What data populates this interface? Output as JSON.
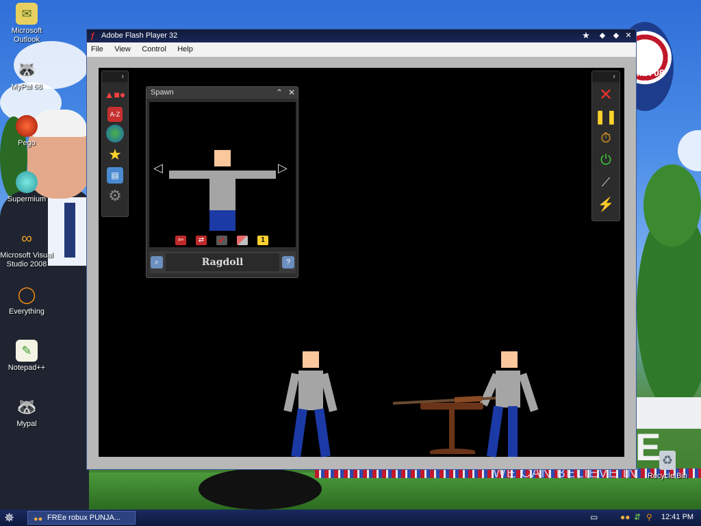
{
  "desktop": {
    "icons": [
      {
        "label": "Microsoft\nOutlook",
        "icon": "outlook-icon"
      },
      {
        "label": "MyPal 68",
        "icon": "raccoon-icon"
      },
      {
        "label": "Pego",
        "icon": "pego-icon"
      },
      {
        "label": "Supermium",
        "icon": "supermium-icon"
      },
      {
        "label": "Microsoft Visual\nStudio 2008",
        "icon": "visual-studio-icon"
      },
      {
        "label": "Everything",
        "icon": "search-ring-icon"
      },
      {
        "label": "Notepad++",
        "icon": "notepad-icon"
      },
      {
        "label": "Mypal",
        "icon": "raccoon-icon"
      },
      {
        "label": "Recycle Bin",
        "icon": "recycle-bin-icon"
      }
    ],
    "wallpaper_text": {
      "slogan": "WE CAN BELIEVE IN",
      "big_letter": "E",
      "logo_text": "MA'08"
    }
  },
  "window": {
    "title": "Adobe Flash Player 32",
    "menu": [
      "File",
      "View",
      "Control",
      "Help"
    ]
  },
  "spawn_panel": {
    "title": "Spawn",
    "item_name": "Ragdoll",
    "count_badge": "1"
  },
  "taskbar": {
    "task_label": "FREe robux PUNJA...",
    "clock": "12:41 PM"
  },
  "colors": {
    "stage_bg": "#000000",
    "ragdoll_skin": "#fbc79c",
    "ragdoll_body": "#a5a5a5",
    "ragdoll_legs": "#1c3aa6",
    "titlebar": "#101a3c"
  }
}
